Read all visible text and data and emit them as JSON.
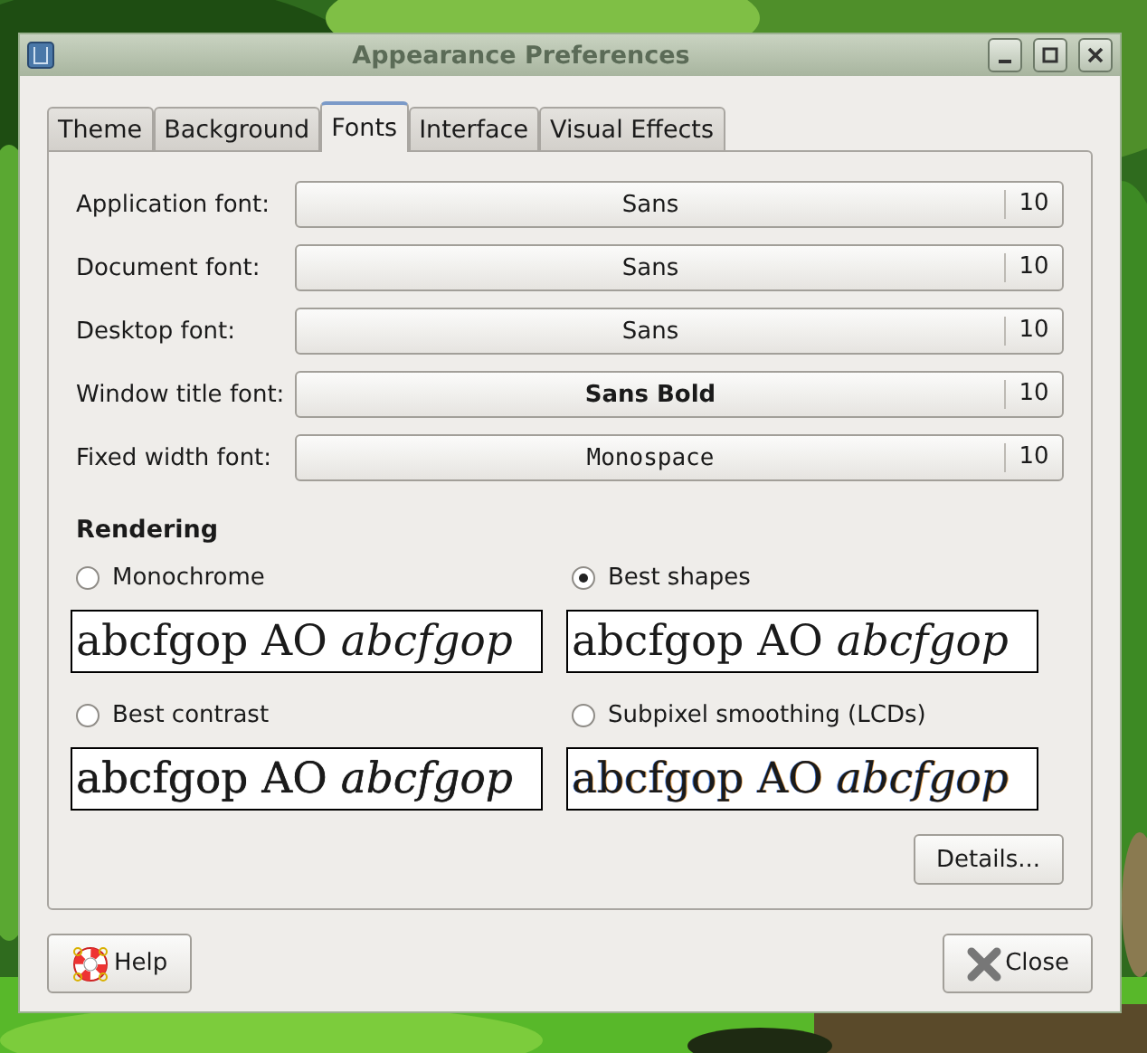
{
  "window": {
    "title": "Appearance Preferences"
  },
  "tabs": [
    {
      "label": "Theme",
      "selected": false
    },
    {
      "label": "Background",
      "selected": false
    },
    {
      "label": "Fonts",
      "selected": true
    },
    {
      "label": "Interface",
      "selected": false
    },
    {
      "label": "Visual Effects",
      "selected": false
    }
  ],
  "fonts": [
    {
      "label": "Application font:",
      "font": "Sans",
      "size": "10",
      "kind": "regular"
    },
    {
      "label": "Document font:",
      "font": "Sans",
      "size": "10",
      "kind": "regular"
    },
    {
      "label": "Desktop font:",
      "font": "Sans",
      "size": "10",
      "kind": "regular"
    },
    {
      "label": "Window title font:",
      "font": "Sans Bold",
      "size": "10",
      "kind": "bold"
    },
    {
      "label": "Fixed width font:",
      "font": "Monospace",
      "size": "10",
      "kind": "mono"
    }
  ],
  "rendering": {
    "title": "Rendering",
    "options": [
      {
        "label": "Monochrome",
        "selected": false,
        "kind": "monochrome",
        "sample": "abcfgop AO *abcfgop*"
      },
      {
        "label": "Best shapes",
        "selected": true,
        "kind": "shapes",
        "sample": "abcfgop AO *abcfgop*"
      },
      {
        "label": "Best contrast",
        "selected": false,
        "kind": "contrast",
        "sample": "abcfgop AO *abcfgop*"
      },
      {
        "label": "Subpixel smoothing (LCDs)",
        "selected": false,
        "kind": "subpixel",
        "sample": "abcfgop AO *abcfgop*"
      }
    ]
  },
  "details_button": "Details...",
  "buttons": [
    {
      "label": "Help",
      "kind": "help"
    },
    {
      "label": "Close",
      "kind": "close"
    }
  ]
}
